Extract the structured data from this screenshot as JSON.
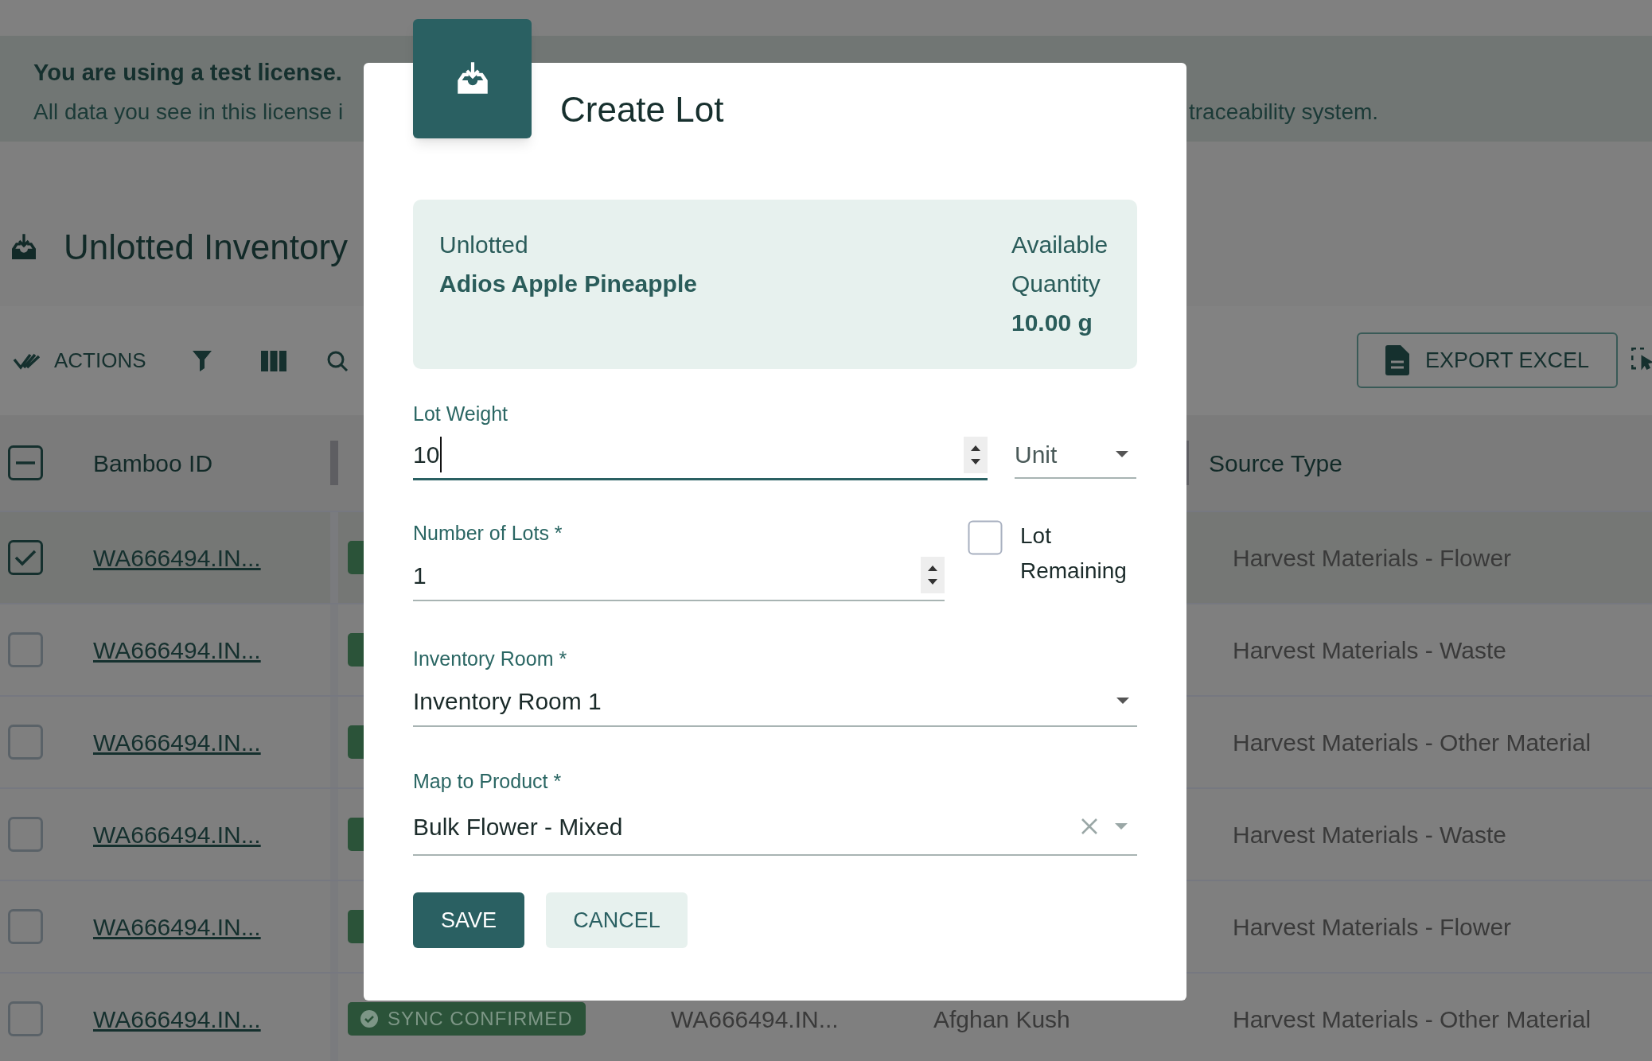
{
  "banner": {
    "title": "You are using a test license.",
    "message": "All data you see in this license i",
    "message_end": "traceability system."
  },
  "page": {
    "title": "Unlotted Inventory"
  },
  "toolbar": {
    "actions_label": "ACTIONS",
    "export_label": "EXPORT EXCEL"
  },
  "table": {
    "header_checkbox": {
      "indeterminate": true
    },
    "columns": [
      "Bamboo ID",
      "Source Type"
    ],
    "rows": [
      {
        "checked": true,
        "bamboo_id": "WA666494.IN...",
        "source_type": "Harvest Materials - Flower"
      },
      {
        "checked": false,
        "bamboo_id": "WA666494.IN...",
        "source_type": "Harvest Materials - Waste"
      },
      {
        "checked": false,
        "bamboo_id": "WA666494.IN...",
        "source_type": "Harvest Materials - Other Material"
      },
      {
        "checked": false,
        "bamboo_id": "WA666494.IN...",
        "source_type": "Harvest Materials - Waste"
      },
      {
        "checked": false,
        "bamboo_id": "WA666494.IN...",
        "source_type": "Harvest Materials - Flower"
      },
      {
        "checked": false,
        "bamboo_id": "WA666494.IN...",
        "status": "SYNC CONFIRMED",
        "column_3": "WA666494.IN...",
        "column_4": "Afghan Kush",
        "source_type": "Harvest Materials - Other Material"
      }
    ]
  },
  "modal": {
    "title": "Create Lot",
    "summary": {
      "label": "Unlotted",
      "name": "Adios Apple Pineapple",
      "quantity_label": "Available Quantity",
      "quantity": "10.00 g"
    },
    "lot_weight": {
      "label": "Lot Weight",
      "value": "10",
      "focused": true
    },
    "unit": {
      "placeholder": "Unit"
    },
    "number_of_lots": {
      "label": "Number of Lots *",
      "value": "1"
    },
    "lot_remaining": {
      "label": "Lot Remaining",
      "checked": false
    },
    "inventory_room": {
      "label": "Inventory Room *",
      "value": "Inventory Room 1"
    },
    "product": {
      "label": "Map to Product *",
      "value": "Bulk Flower - Mixed",
      "clearable": true
    },
    "buttons": [
      {
        "label": "SAVE",
        "kind": "primary"
      },
      {
        "label": "CANCEL",
        "kind": "secondary"
      }
    ]
  }
}
